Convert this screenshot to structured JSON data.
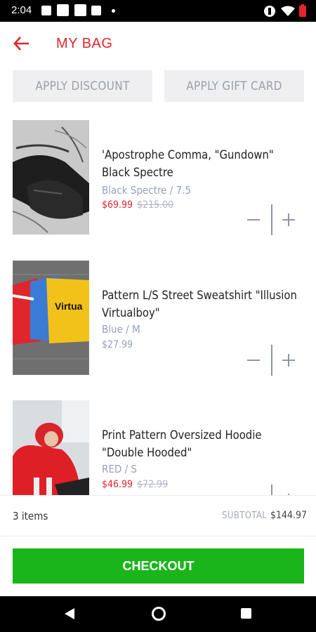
{
  "status_bar": {
    "time": "2:04"
  },
  "header": {
    "title": "MY BAG"
  },
  "actions": {
    "discount_label": "APPLY DISCOUNT",
    "gift_label": "APPLY GIFT CARD"
  },
  "items": [
    {
      "name": "'Apostrophe Comma, \"Gundown\" Black Spectre",
      "variant": "Black Spectre / 7.5",
      "sale_price": "$69.99",
      "original_price": "$215.00"
    },
    {
      "name": "Pattern L/S Street Sweatshirt \"Illusion Virtualboy\"",
      "variant": "Blue / M",
      "price": "$27.99"
    },
    {
      "name": "Print Pattern Oversized Hoodie \"Double Hooded\"",
      "variant": "RED / S",
      "sale_price": "$46.99",
      "original_price": "$72.99"
    }
  ],
  "summary": {
    "count": "3 items",
    "subtotal_label": "SUBTOTAL",
    "subtotal_value": "$144.97"
  },
  "checkout": {
    "label": "CHECKOUT"
  },
  "colors": {
    "accent": "#e4252b",
    "checkout": "#1ab51a",
    "muted": "#97a0b8"
  }
}
